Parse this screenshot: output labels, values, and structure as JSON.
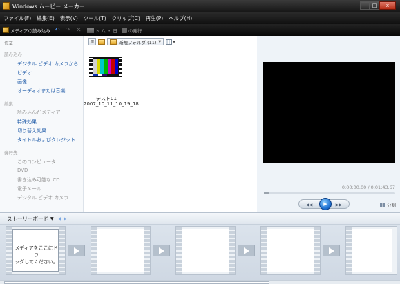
{
  "window": {
    "title": "Windows ムービー メーカー",
    "buttons": {
      "minimize": "–",
      "maximize": "□",
      "close": "x"
    }
  },
  "menu": [
    "ファイル(F)",
    "編集(E)",
    "表示(V)",
    "ツール(T)",
    "クリップ(C)",
    "再生(P)",
    "ヘルプ(H)"
  ],
  "toolbar": {
    "import_label": "メディアの読み込み",
    "undo_glyph": "↶",
    "redo_glyph": "↷",
    "delete_glyph": "✕",
    "movie_label": "ト ム ・ 日",
    "publish_label": "の発行"
  },
  "tasks": {
    "title": "作業",
    "sections": [
      {
        "heading": "読み込み",
        "links": [
          "デジタル ビデオ カメラから",
          "ビデオ",
          "画像",
          "オーディオまたは音楽"
        ]
      },
      {
        "heading": "編集",
        "links": [
          "読み込んだメディア",
          "特殊効果",
          "切り替え効果",
          "タイトルおよびクレジット"
        ]
      },
      {
        "heading": "発行先",
        "links": [
          "このコンピュータ",
          "DVD",
          "書き込み可能な CD",
          "電子メール",
          "デジタル ビデオ カメラ"
        ]
      }
    ]
  },
  "collection": {
    "folder": "新規フォルダ (11)",
    "clip": {
      "name": "テスト01",
      "date": "2007_10_11_10_19_18"
    },
    "colors": [
      "#cfcfcf",
      "#d8d800",
      "#00c8c8",
      "#00b400",
      "#c800c8",
      "#c80000",
      "#0000c8"
    ]
  },
  "preview": {
    "time": "0:00:00.00 / 0:01:43.67",
    "split_label": "分割"
  },
  "storyboard": {
    "label": "ストーリーボード",
    "drop_text_line1": "メディアをここにドラ",
    "drop_text_line2": "ッグしてください。"
  }
}
